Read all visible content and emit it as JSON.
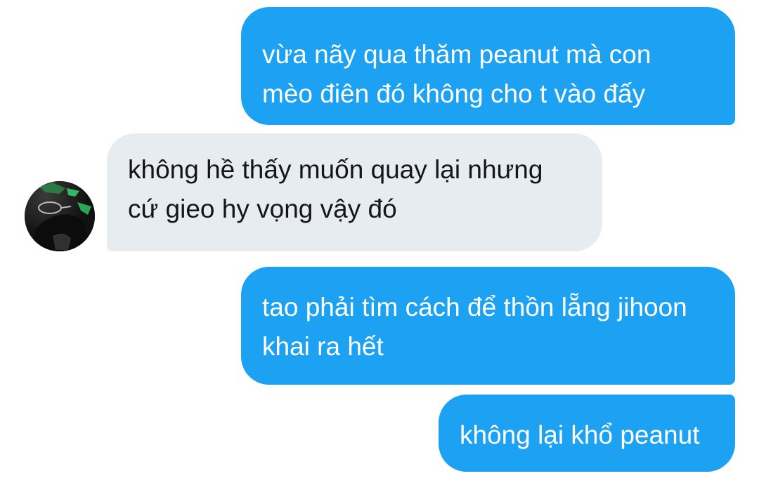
{
  "messages": [
    {
      "direction": "outgoing",
      "lines": [
        "vừa nãy qua thăm peanut mà con",
        "mèo điên đó không cho t vào đấy"
      ]
    },
    {
      "direction": "incoming",
      "lines": [
        "không hề thấy muốn quay lại nhưng",
        "cứ gieo hy vọng vậy đó"
      ]
    },
    {
      "direction": "outgoing",
      "lines": [
        "tao phải tìm cách để thồn lẵng jihoon",
        "khai ra hết"
      ]
    },
    {
      "direction": "outgoing",
      "lines": [
        "không lại khổ peanut"
      ]
    }
  ],
  "colors": {
    "outgoing_bubble": "#1DA1F2",
    "incoming_bubble": "#E6ECF0",
    "outgoing_text": "#FFFFFF",
    "incoming_text": "#14171A"
  },
  "avatar": {
    "icon": "user-avatar-photo"
  }
}
